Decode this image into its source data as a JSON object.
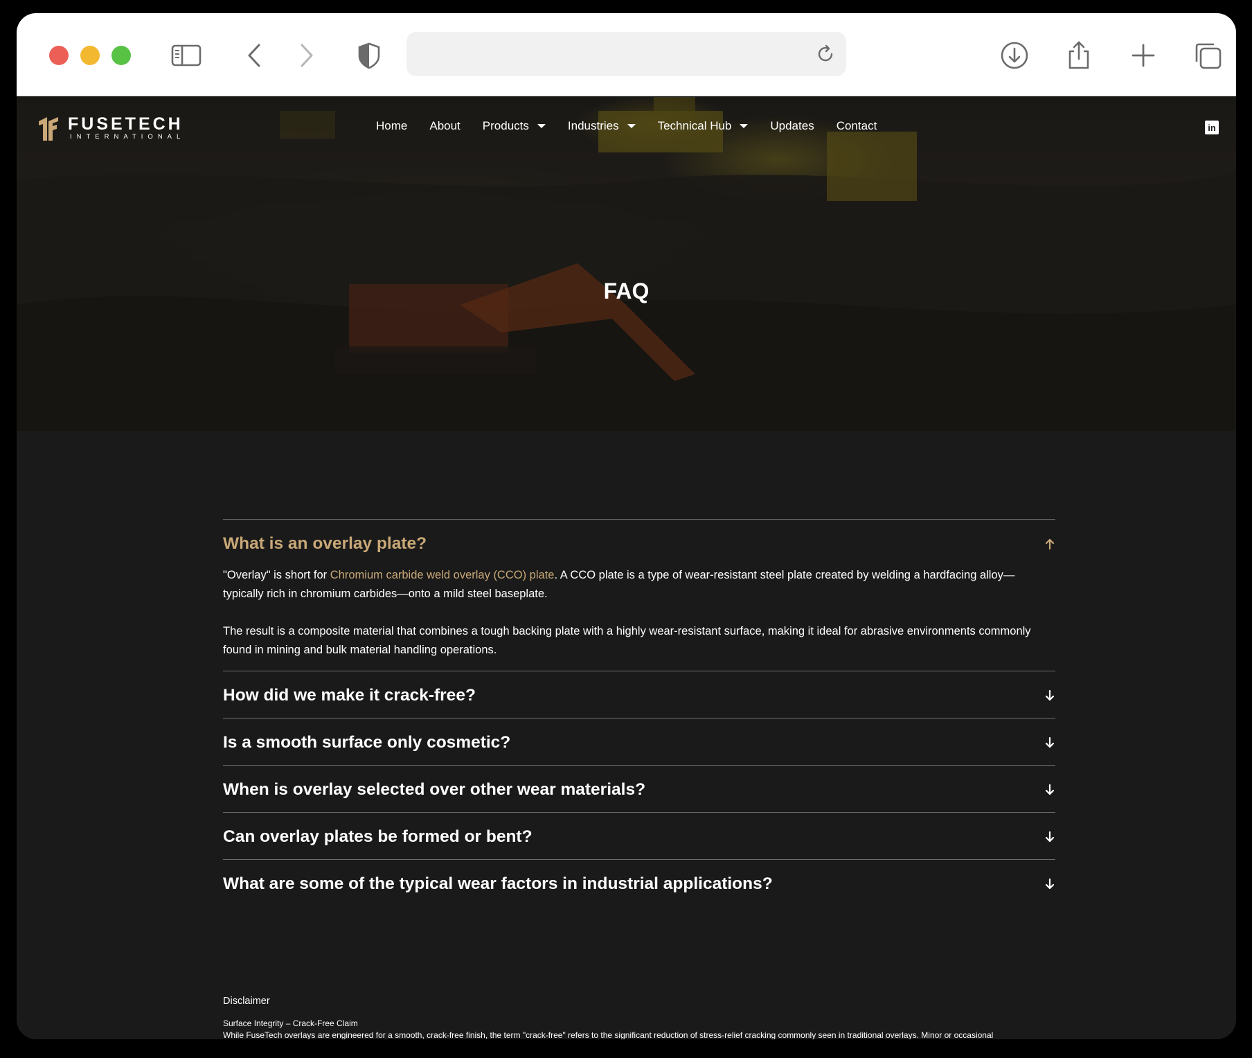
{
  "browser": {
    "url": "",
    "colors": {
      "close": "#ec5f57",
      "minimize": "#f2b930",
      "maximize": "#58c245"
    }
  },
  "site": {
    "logo": {
      "name": "FUSETECH",
      "sub": "INTERNATIONAL"
    },
    "nav": [
      {
        "label": "Home",
        "dropdown": false
      },
      {
        "label": "About",
        "dropdown": false
      },
      {
        "label": "Products",
        "dropdown": true
      },
      {
        "label": "Industries",
        "dropdown": true
      },
      {
        "label": "Technical Hub",
        "dropdown": true
      },
      {
        "label": "Updates",
        "dropdown": false
      },
      {
        "label": "Contact",
        "dropdown": false
      }
    ],
    "social_icon": "linkedin-icon",
    "accent": "#c9a877"
  },
  "hero": {
    "title": "FAQ"
  },
  "faq": {
    "items": [
      {
        "question": "What is an overlay plate?",
        "open": true,
        "answer": {
          "p1_prefix": "\"Overlay\" is short for ",
          "p1_link": "Chromium carbide weld overlay (CCO) plate",
          "p1_suffix": ". A CCO plate is a type of wear-resistant steel plate created by welding a hardfacing alloy—typically rich in chromium carbides—onto a mild steel baseplate.",
          "p2": "The result is a composite material that combines a tough backing plate with a highly wear-resistant surface, making it ideal for abrasive environments commonly found in mining and bulk material handling operations."
        }
      },
      {
        "question": "How did we make it crack-free?",
        "open": false
      },
      {
        "question": "Is a smooth surface only cosmetic?",
        "open": false
      },
      {
        "question": "When is overlay selected over other wear materials?",
        "open": false
      },
      {
        "question": "Can overlay plates be formed or bent?",
        "open": false
      },
      {
        "question": "What are some of the typical wear factors in industrial applications?",
        "open": false
      }
    ]
  },
  "disclaimer": {
    "heading": "Disclaimer",
    "title": "Surface Integrity – Crack-Free Claim",
    "body": "While FuseTech overlays are engineered for a smooth, crack-free finish, the term \"crack-free\" refers to the significant reduction of stress-relief cracking commonly seen in traditional overlays. Minor or occasional"
  }
}
